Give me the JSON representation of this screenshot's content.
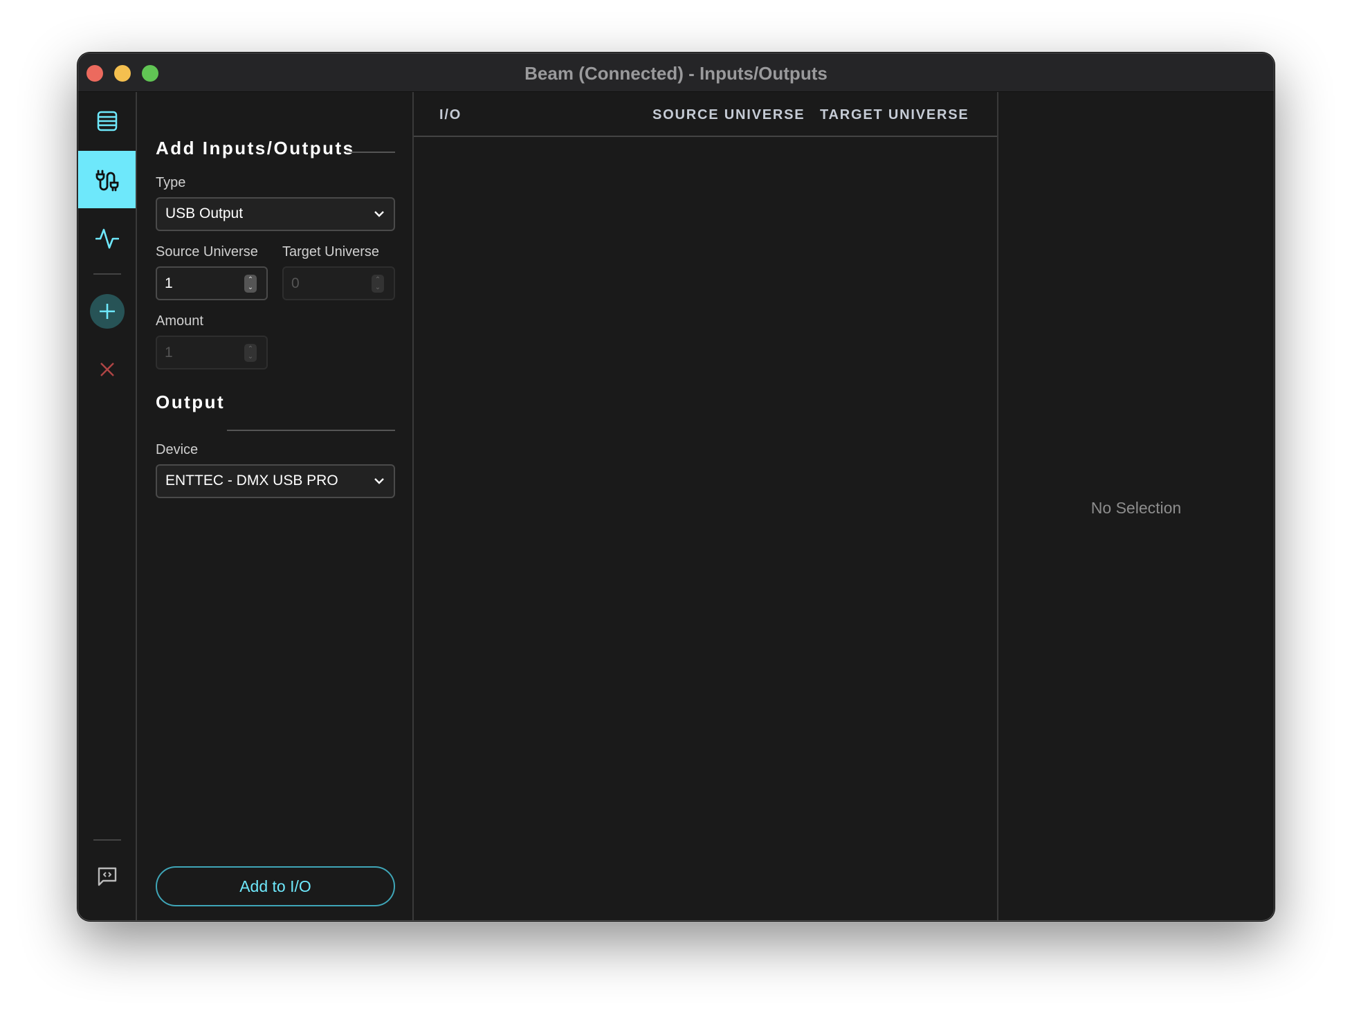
{
  "window": {
    "title": "Beam (Connected) - Inputs/Outputs"
  },
  "colors": {
    "accent": "#6ee8fb",
    "danger": "#b04545",
    "background": "#1a1a1a"
  },
  "sidebar": {
    "items": [
      {
        "icon": "list-icon",
        "active": false
      },
      {
        "icon": "plug-cable-icon",
        "active": true
      },
      {
        "icon": "activity-pulse-icon",
        "active": false
      },
      {
        "icon": "plus-icon",
        "active": false
      },
      {
        "icon": "close-x-icon",
        "active": false
      },
      {
        "icon": "code-chat-icon",
        "active": false
      },
      {
        "icon": "gear-icon",
        "active": false
      }
    ]
  },
  "form": {
    "heading": "Add Inputs/Outputs",
    "type_label": "Type",
    "type_value": "USB Output",
    "source_label": "Source Universe",
    "source_value": "1",
    "target_label": "Target Universe",
    "target_value": "0",
    "amount_label": "Amount",
    "amount_value": "1",
    "output_heading": "Output",
    "device_label": "Device",
    "device_value": "ENTTEC - DMX USB PRO",
    "add_button": "Add to I/O"
  },
  "table": {
    "columns": [
      "I/O",
      "SOURCE UNIVERSE",
      "TARGET UNIVERSE"
    ],
    "rows": []
  },
  "detail": {
    "empty_text": "No Selection"
  }
}
